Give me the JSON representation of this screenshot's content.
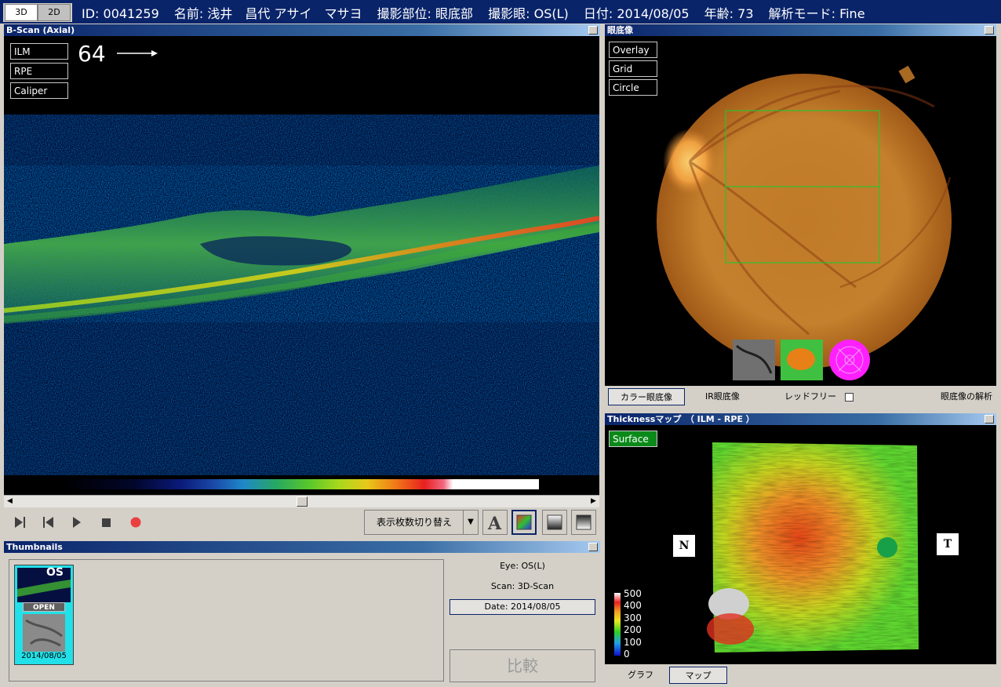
{
  "header": {
    "mode_tabs": [
      "3D",
      "2D"
    ],
    "id": "ID: 0041259",
    "name": "名前: 浅井　昌代 アサイ　マサヨ",
    "region": "撮影部位: 眼底部",
    "eye": "撮影眼: OS(L)",
    "date": "日付: 2014/08/05",
    "age": "年齢: 73",
    "mode": "解析モード: Fine"
  },
  "bscan": {
    "title": "B-Scan (Axial)",
    "overlay_buttons": [
      "ILM",
      "RPE",
      "Caliper"
    ],
    "slice_number": "64",
    "slider_position": 0.5
  },
  "toolbar": {
    "display_dropdown": "表示枚数切り替え",
    "icons": [
      "skip-end-icon",
      "skip-start-icon",
      "play-icon",
      "stop-icon",
      "record-icon",
      "font-icon",
      "color-map-icon",
      "gray-map-icon",
      "invert-map-icon"
    ]
  },
  "thumbnails": {
    "title": "Thumbnails",
    "eye_badge": "OS",
    "open_badge": "OPEN",
    "thumb_date": "2014/08/05",
    "eye_info": "Eye: OS(L)",
    "scan_info": "Scan: 3D-Scan",
    "date_info": "Date: 2014/08/05",
    "compare_button": "比較"
  },
  "fundus": {
    "title": "眼底像",
    "overlay_buttons": [
      "Overlay",
      "Grid",
      "Circle"
    ],
    "tabs": [
      "カラー眼底像",
      "IR眼底像",
      "レッドフリー",
      "眼底像の解析"
    ]
  },
  "thickness": {
    "title": "Thicknessマップ　（ ILM - RPE ）",
    "surface_button": "Surface",
    "nasal_label": "N",
    "temporal_label": "T",
    "legend_labels": [
      "500",
      "400",
      "300",
      "200",
      "100",
      "0"
    ],
    "tabs": [
      "グラフ",
      "マップ"
    ]
  },
  "colors": {
    "title_bar": "#0a246a",
    "window_bg": "#d4d0c8",
    "surface_active": "#0b8a1a",
    "record": "#e84040"
  }
}
